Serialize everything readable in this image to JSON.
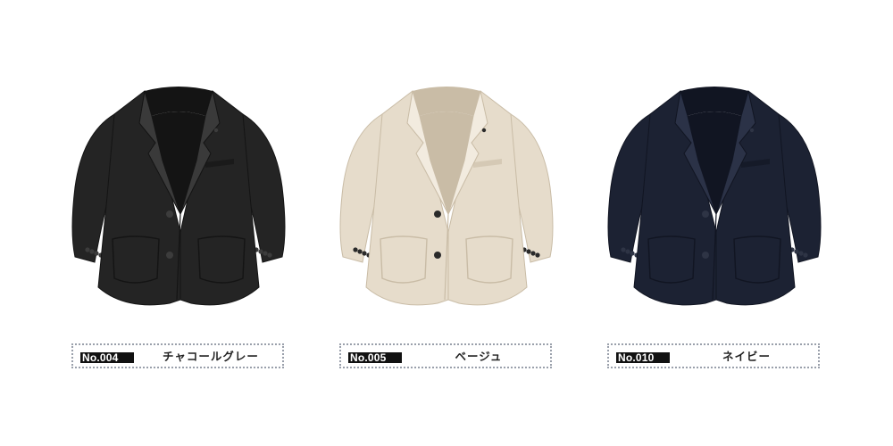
{
  "products": [
    {
      "code": "No.004",
      "color_name": "チャコールグレー",
      "swatch": "#242424",
      "shade": "#141414",
      "highlight": "#3a3a3a",
      "button": "#3c3c3c"
    },
    {
      "code": "No.005",
      "color_name": "ベージュ",
      "swatch": "#e6dccb",
      "shade": "#c9bca6",
      "highlight": "#f2ebdf",
      "button": "#2a2a2a"
    },
    {
      "code": "No.010",
      "color_name": "ネイビー",
      "swatch": "#1c2233",
      "shade": "#111522",
      "highlight": "#2b3247",
      "button": "#2e3445"
    }
  ]
}
